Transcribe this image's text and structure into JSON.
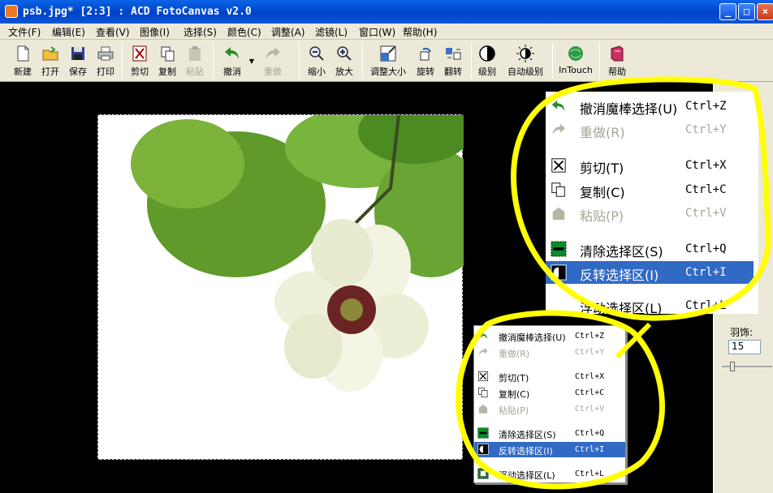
{
  "window": {
    "title": "psb.jpg* [2:3] : ACD FotoCanvas v2.0"
  },
  "menubar": [
    "文件(F)",
    "编辑(E)",
    "查看(V)",
    "图像(I)",
    "选择(S)",
    "颜色(C)",
    "调整(A)",
    "滤镜(L)",
    "窗口(W)",
    "帮助(H)"
  ],
  "toolbar": [
    {
      "label": "新建",
      "icon": "new-icon",
      "enabled": true
    },
    {
      "label": "打开",
      "icon": "open-icon",
      "enabled": true
    },
    {
      "label": "保存",
      "icon": "save-icon",
      "enabled": true
    },
    {
      "label": "打印",
      "icon": "print-icon",
      "enabled": true
    },
    {
      "label": "剪切",
      "icon": "cut-icon",
      "enabled": true
    },
    {
      "label": "复制",
      "icon": "copy-icon",
      "enabled": true
    },
    {
      "label": "粘贴",
      "icon": "paste-icon",
      "enabled": false
    },
    {
      "label": "撤消",
      "icon": "undo-icon",
      "enabled": true
    },
    {
      "label": "重做",
      "icon": "redo-icon",
      "enabled": false
    },
    {
      "label": "缩小",
      "icon": "zoom-out-icon",
      "enabled": true
    },
    {
      "label": "放大",
      "icon": "zoom-in-icon",
      "enabled": true
    },
    {
      "label": "调整大小",
      "icon": "resize-icon",
      "enabled": true
    },
    {
      "label": "旋转",
      "icon": "rotate-icon",
      "enabled": true
    },
    {
      "label": "翻转",
      "icon": "flip-icon",
      "enabled": true
    },
    {
      "label": "级别",
      "icon": "levels-icon",
      "enabled": true
    },
    {
      "label": "自动级别",
      "icon": "auto-levels-icon",
      "enabled": true
    },
    {
      "label": "InTouch",
      "icon": "intouch-icon",
      "enabled": true
    },
    {
      "label": "帮助",
      "icon": "help-book-icon",
      "enabled": true
    }
  ],
  "context_menu": {
    "items": [
      {
        "label": "撤消魔棒选择(U)",
        "shortcut": "Ctrl+Z",
        "icon": "undo-icon",
        "enabled": true
      },
      {
        "label": "重做(R)",
        "shortcut": "Ctrl+Y",
        "icon": "redo-icon",
        "enabled": false
      },
      {
        "label": "剪切(T)",
        "shortcut": "Ctrl+X",
        "icon": "cut-icon",
        "enabled": true
      },
      {
        "label": "复制(C)",
        "shortcut": "Ctrl+C",
        "icon": "copy-icon",
        "enabled": true
      },
      {
        "label": "粘贴(P)",
        "shortcut": "Ctrl+V",
        "icon": "paste-icon",
        "enabled": false
      },
      {
        "label": "清除选择区(S)",
        "shortcut": "Ctrl+Q",
        "icon": "clear-selection-icon",
        "enabled": true
      },
      {
        "label": "反转选择区(I)",
        "shortcut": "Ctrl+I",
        "icon": "invert-selection-icon",
        "enabled": true,
        "selected": true
      },
      {
        "label": "浮动选择区(L)",
        "shortcut": "Ctrl+L",
        "icon": "float-selection-icon",
        "enabled": true
      }
    ]
  },
  "side_panel": {
    "feather_label": "羽饰:",
    "feather_value": "15"
  },
  "colors": {
    "title_bar": "#0a5ce0",
    "menu_highlight": "#316ac5",
    "annotation": "#ffff00",
    "chrome": "#ece9d8"
  }
}
